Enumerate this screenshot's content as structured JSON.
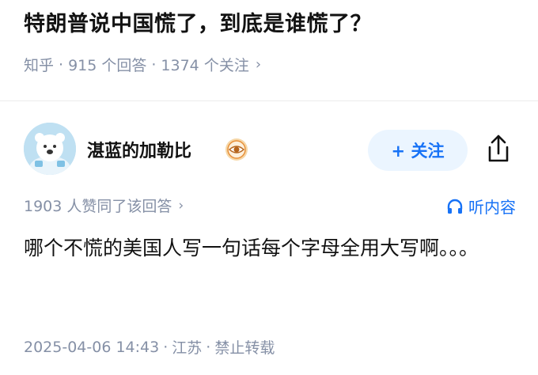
{
  "question": {
    "title": "特朗普说中国慌了，到底是谁慌了？",
    "source": "知乎",
    "answer_count": "915 个回答",
    "follow_count": "1374 个关注",
    "separator": "·",
    "chevron": "›"
  },
  "author": {
    "name": "湛蓝的加勒比",
    "avatar_icon": "polar-bear-avatar",
    "badge_icon": "eye-badge-icon"
  },
  "actions": {
    "follow_label": "+ 关注",
    "share_icon": "share-icon",
    "listen_label": "听内容",
    "listen_icon": "headphones-icon"
  },
  "answer": {
    "upvote_text": "1903 人赞同了该回答",
    "body": "哪个不慌的美国人写一句话每个字母全用大写啊。。。",
    "date": "2025-04-06 14:43",
    "location": "江苏",
    "repost": "禁止转载"
  },
  "colors": {
    "brand_blue": "#1772f6",
    "follow_bg": "#ebf5ff",
    "meta_gray": "#8590a6",
    "badge_orange": "#e8903a"
  }
}
